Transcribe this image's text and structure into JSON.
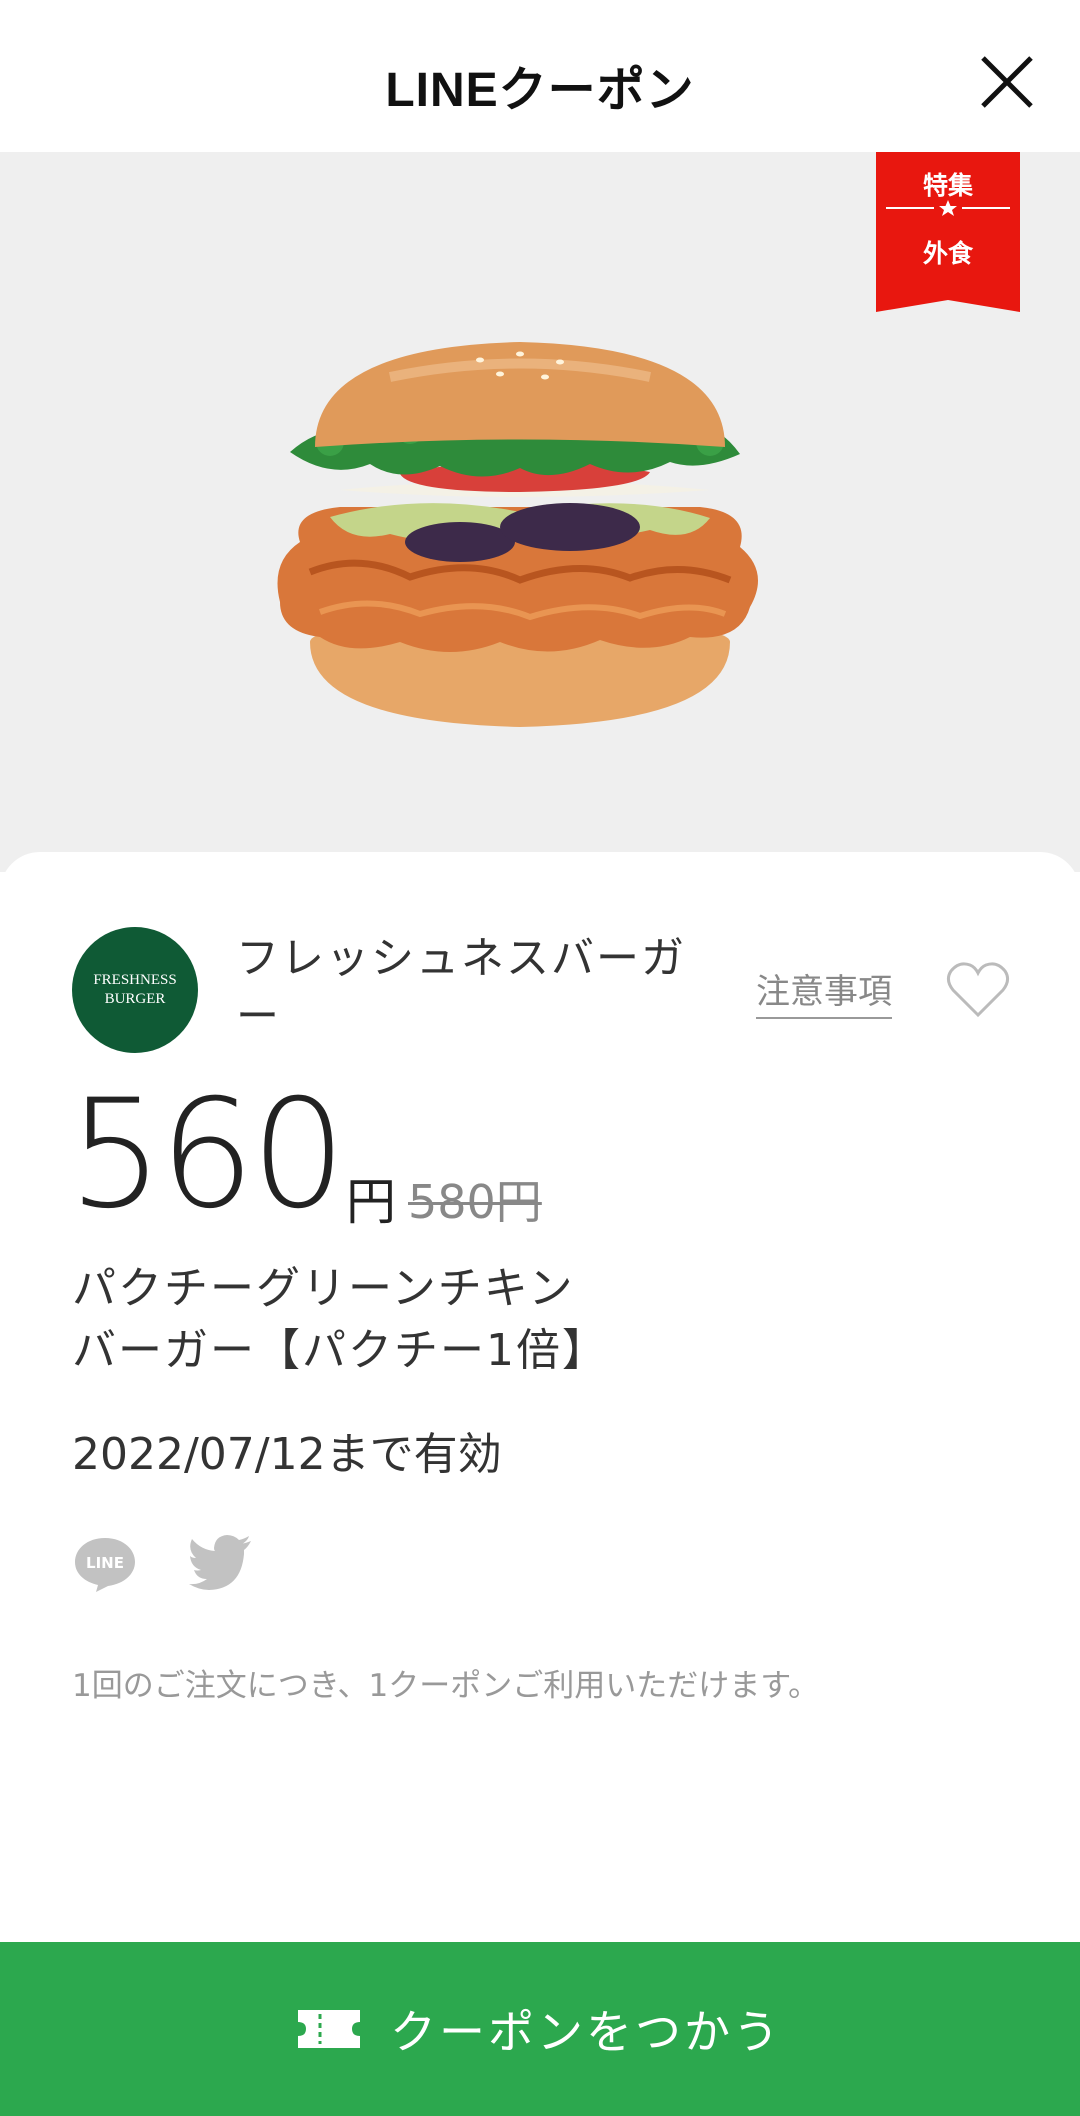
{
  "header": {
    "title": "LINEクーポン"
  },
  "hero": {
    "ribbon_top": "特集",
    "ribbon_bottom": "外食",
    "ribbon_color": "#e8170f"
  },
  "brand": {
    "name": "フレッシュネスバーガー",
    "logo_line1": "FRESHNESS",
    "logo_line2": "BURGER",
    "logo_color": "#0f5a35"
  },
  "links": {
    "notes": "注意事項"
  },
  "price": {
    "current": "560",
    "unit": "円",
    "original": "580円"
  },
  "product": {
    "name_line1": "パクチーグリーンチキン",
    "name_line2": "バーガー【パクチー1倍】"
  },
  "validity": "2022/07/12まで有効",
  "share": {
    "line_label": "LINE"
  },
  "notice": "1回のご注文につき、1クーポンご利用いただけます。",
  "cta": {
    "label": "クーポンをつかう",
    "color": "#2ca84e"
  }
}
